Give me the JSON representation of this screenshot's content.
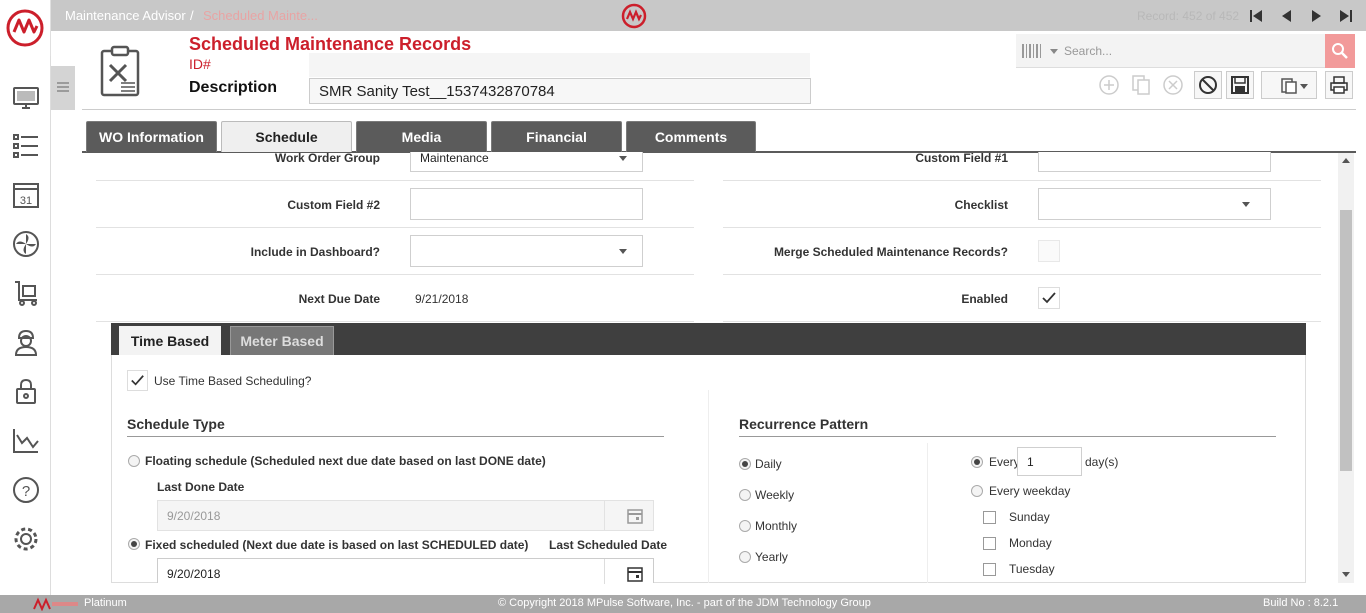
{
  "breadcrumb": {
    "root": "Maintenance Advisor",
    "separator": "/",
    "current": "Scheduled Mainte..."
  },
  "record_counter": "Record: 452 of 452",
  "search": {
    "placeholder": "Search..."
  },
  "header": {
    "title": "Scheduled Maintenance Records",
    "id_label": "ID#",
    "description_label": "Description",
    "description_value": "SMR Sanity Test__1537432870784"
  },
  "tabs": [
    {
      "label": "WO Information"
    },
    {
      "label": "Schedule"
    },
    {
      "label": "Media"
    },
    {
      "label": "Financial"
    },
    {
      "label": "Comments"
    }
  ],
  "form": {
    "work_order_group": {
      "label": "Work Order Group",
      "value": "Maintenance"
    },
    "custom_field_1": {
      "label": "Custom Field #1",
      "value": ""
    },
    "custom_field_2": {
      "label": "Custom Field #2",
      "value": ""
    },
    "checklist": {
      "label": "Checklist",
      "value": ""
    },
    "include_in_dashboard": {
      "label": "Include in Dashboard?",
      "value": ""
    },
    "merge_smr": {
      "label": "Merge Scheduled Maintenance Records?",
      "checked": false
    },
    "next_due_date": {
      "label": "Next Due Date",
      "value": "9/21/2018"
    },
    "enabled": {
      "label": "Enabled",
      "checked": true
    }
  },
  "subtabs": [
    {
      "label": "Time Based"
    },
    {
      "label": "Meter Based"
    }
  ],
  "time_based": {
    "use_label": "Use Time Based Scheduling?",
    "schedule_type_title": "Schedule Type",
    "floating_label": "Floating schedule (Scheduled next due date based on last DONE date)",
    "last_done_label": "Last Done Date",
    "last_done_value": "9/20/2018",
    "fixed_label": "Fixed scheduled (Next due date is based on last SCHEDULED date)",
    "last_scheduled_label": "Last Scheduled Date",
    "last_scheduled_value": "9/20/2018",
    "recurrence_title": "Recurrence Pattern",
    "patterns": [
      "Daily",
      "Weekly",
      "Monthly",
      "Yearly"
    ],
    "every_label": "Every",
    "every_value": "1",
    "days_suffix": "day(s)",
    "every_weekday_label": "Every weekday",
    "weekdays": [
      "Sunday",
      "Monday",
      "Tuesday"
    ]
  },
  "footer": {
    "edition": "Platinum",
    "copyright": "© Copyright 2018 MPulse Software, Inc. - part of the JDM Technology Group",
    "build": "Build No : 8.2.1"
  },
  "colors": {
    "brand_red": "#cc1f2b",
    "tab_dark": "#5b5b5b",
    "topbar": "#c8c8c8",
    "search_button": "#f29a9a"
  }
}
